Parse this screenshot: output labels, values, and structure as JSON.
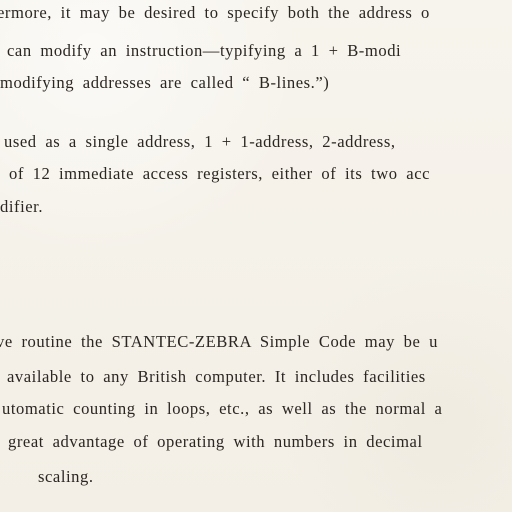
{
  "document": {
    "lines": [
      "ermore,  it  may  be  desired  to  specify  both  the  address  o",
      "can  modify  an  instruction—typifying  a  1  +  B-modi",
      "modifying  addresses  are  called  “ B-lines.”)",
      "used  as  a  single  address,  1  +  1-address,  2-address,",
      "of  12  immediate  access  registers,  either  of  its  two  acc",
      "difier.",
      "ve  routine  the  STANTEC-ZEBRA  Simple  Code  may  be  u",
      "available  to  any  British  computer.   It  includes  facilities",
      "utomatic  counting  in  loops,  etc.,  as  well  as  the  normal  a",
      "great  advantage  of  operating  with  numbers  in  decimal",
      "scaling."
    ]
  }
}
